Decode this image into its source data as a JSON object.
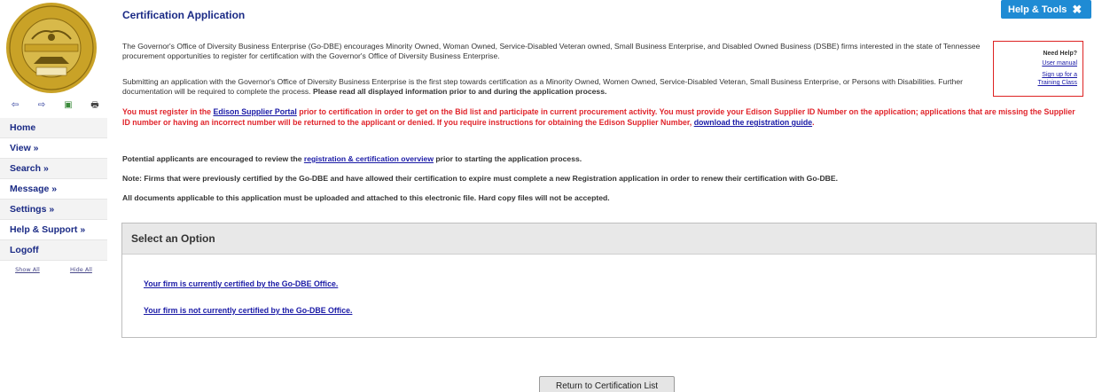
{
  "sidebar": {
    "seal_text_top": "THE STATE OF",
    "seal_text_left": "THE GREAT SEAL OF",
    "seal_text_right": "TENNESSEE",
    "seal_center_top": "AGRICULTURE",
    "seal_center_bottom": "COMMERCE",
    "seal_year": "1796",
    "tools": [
      "back-arrow-icon",
      "forward-arrow-icon",
      "refresh-icon",
      "print-icon"
    ],
    "items": [
      {
        "label": "Home"
      },
      {
        "label": "View »"
      },
      {
        "label": "Search »"
      },
      {
        "label": "Message »"
      },
      {
        "label": "Settings »"
      },
      {
        "label": "Help & Support »"
      },
      {
        "label": "Logoff"
      }
    ],
    "show_all": "Show All",
    "hide_all": "Hide All"
  },
  "header": {
    "title": "Certification Application",
    "help_tools": "Help & Tools"
  },
  "help_box": {
    "title": "Need Help?",
    "user_manual": "User manual",
    "training_line1": "Sign up for a",
    "training_line2": "Training Class"
  },
  "content": {
    "p1": "The Governor's Office of Diversity Business Enterprise (Go-DBE) encourages Minority Owned, Woman Owned, Service-Disabled Veteran owned, Small Business Enterprise, and Disabled Owned Business (DSBE) firms interested in the state of Tennessee procurement opportunities to register for certification with the Governor's Office of Diversity Business Enterprise.",
    "p2_normal": "Submitting an application with the Governor's Office of Diversity Business Enterprise is the first step towards certification as a Minority Owned, Women Owned, Service-Disabled Veteran, Small Business Enterprise, or Persons with Disabilities. Further documentation will be required to complete the process. ",
    "p2_bold": "Please read all displayed information prior to and during the application process.",
    "p3_a": "You must register in the ",
    "p3_link1": "Edison Supplier Portal",
    "p3_b": " prior to certification in order to get on the Bid list and participate in current procurement activity. You must provide your Edison Supplier ID Number on the application; applications that are missing the Supplier ID number or having an incorrect number will be returned to the applicant or denied. If you require instructions for obtaining the Edison Supplier Number, ",
    "p3_link2": "download the registration guide",
    "p3_c": ".",
    "p4_a": "Potential applicants are encouraged to review the ",
    "p4_link": "registration & certification overview",
    "p4_b": " prior to starting the application process.",
    "p5": "Note: Firms that were previously certified by the Go-DBE and have allowed their certification to expire must complete a new Registration application in order to renew their certification with Go-DBE.",
    "p6": "All documents applicable to this application must be uploaded and attached to this electronic file. Hard copy files will not be accepted."
  },
  "options": {
    "header": "Select an Option",
    "option1": "Your firm is currently certified by the Go-DBE Office.",
    "option2": "Your firm is not currently certified by the Go-DBE Office."
  },
  "footer": {
    "return_button": "Return to Certification List"
  },
  "colors": {
    "nav_blue": "#1a2a85",
    "link_blue": "#1a1aa6",
    "alert_red": "#e0242b",
    "help_button": "#1f8bd4",
    "seal_gold": "#c9a227"
  }
}
